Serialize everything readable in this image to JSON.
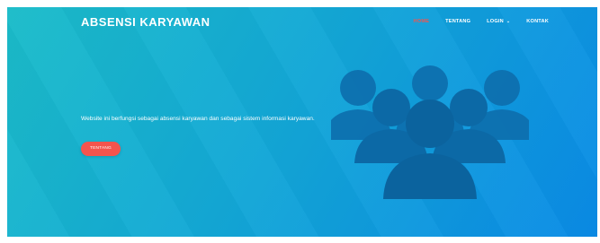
{
  "header": {
    "brand": "ABSENSI KARYAWAN",
    "nav": [
      {
        "label": "HOME",
        "active": true
      },
      {
        "label": "TENTANG",
        "active": false
      },
      {
        "label": "LOGIN",
        "active": false,
        "dropdown": true
      },
      {
        "label": "KONTAK",
        "active": false
      }
    ]
  },
  "hero": {
    "tagline": "Website ini berfungsi sebagai absensi karyawan dan sebagai sistem informasi karyawan.",
    "button_label": "TENTANG",
    "illustration": "group-of-people-icon"
  },
  "colors": {
    "gradient_start": "#1bbcc9",
    "gradient_end": "#0a8be6",
    "accent": "#f4544d",
    "icon_fill": "#0d6fae"
  }
}
